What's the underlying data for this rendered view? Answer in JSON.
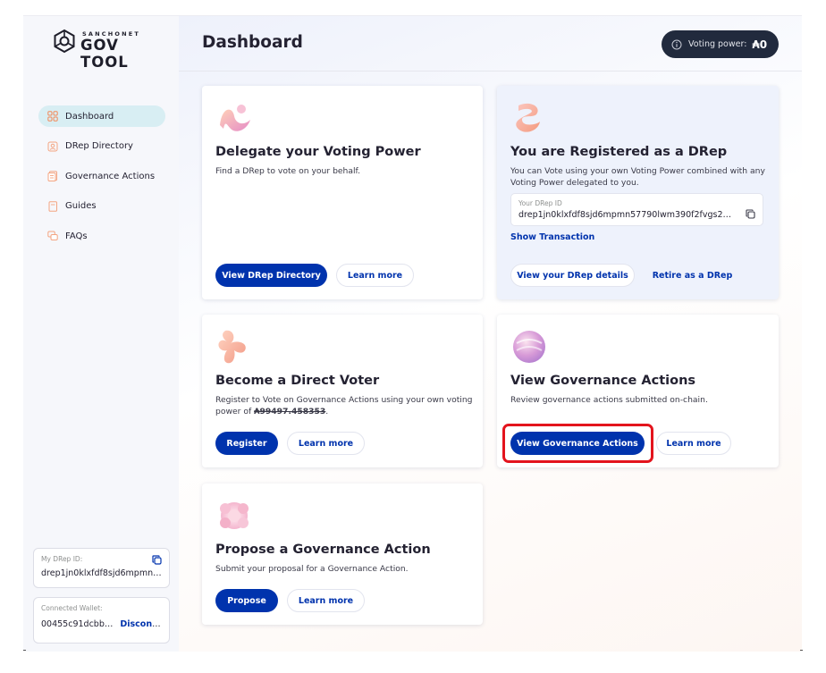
{
  "app": {
    "logo_sub": "SANCHONET",
    "logo_main": "GOV TOOL"
  },
  "sidebar": {
    "items": [
      {
        "label": "Dashboard",
        "icon": "dashboard-grid-icon",
        "active": true
      },
      {
        "label": "DRep Directory",
        "icon": "drep-directory-icon",
        "active": false
      },
      {
        "label": "Governance Actions",
        "icon": "governance-actions-icon",
        "active": false
      },
      {
        "label": "Guides",
        "icon": "guides-book-icon",
        "active": false
      },
      {
        "label": "FAQs",
        "icon": "faqs-chat-icon",
        "active": false
      }
    ],
    "drep_id_label": "My DRep ID:",
    "drep_id_value": "drep1jn0klxfdf8sjd6mpmn57…",
    "wallet_label": "Connected Wallet:",
    "wallet_value": "00455c91dcbb…",
    "disconnect_label": "Disconnect"
  },
  "header": {
    "title": "Dashboard",
    "voting_power_label": "Voting power:",
    "voting_power_value": "₳0"
  },
  "cards": {
    "delegate": {
      "title": "Delegate your Voting Power",
      "desc": "Find a DRep to vote on your behalf.",
      "primary_label": "View DRep Directory",
      "secondary_label": "Learn more"
    },
    "registered": {
      "title": "You are Registered as a DRep",
      "desc": "You can Vote using your own Voting Power combined with any Voting Power delegated to you.",
      "id_label": "Your DRep ID",
      "id_value": "drep1jn0klxfdf8sjd6mpmn5779​0lwm390f2fvgs2cly9…",
      "show_tx_label": "Show Transaction",
      "details_label": "View your DRep details",
      "retire_label": "Retire as a DRep"
    },
    "direct_voter": {
      "title": "Become a Direct Voter",
      "desc_prefix": "Register to Vote on Governance Actions using your own voting power of ",
      "amount": "₳99497.458353",
      "desc_suffix": ".",
      "primary_label": "Register",
      "secondary_label": "Learn more"
    },
    "governance": {
      "title": "View Governance Actions",
      "desc": "Review governance actions submitted on-chain.",
      "primary_label": "View Governance Actions",
      "secondary_label": "Learn more"
    },
    "propose": {
      "title": "Propose a Governance Action",
      "desc": "Submit your proposal for a Governance Action.",
      "primary_label": "Propose",
      "secondary_label": "Learn more"
    }
  },
  "colors": {
    "accent": "#0033ad",
    "highlight": "#e3141d",
    "pill": "#212a3d",
    "active_nav": "#d8eef3"
  }
}
